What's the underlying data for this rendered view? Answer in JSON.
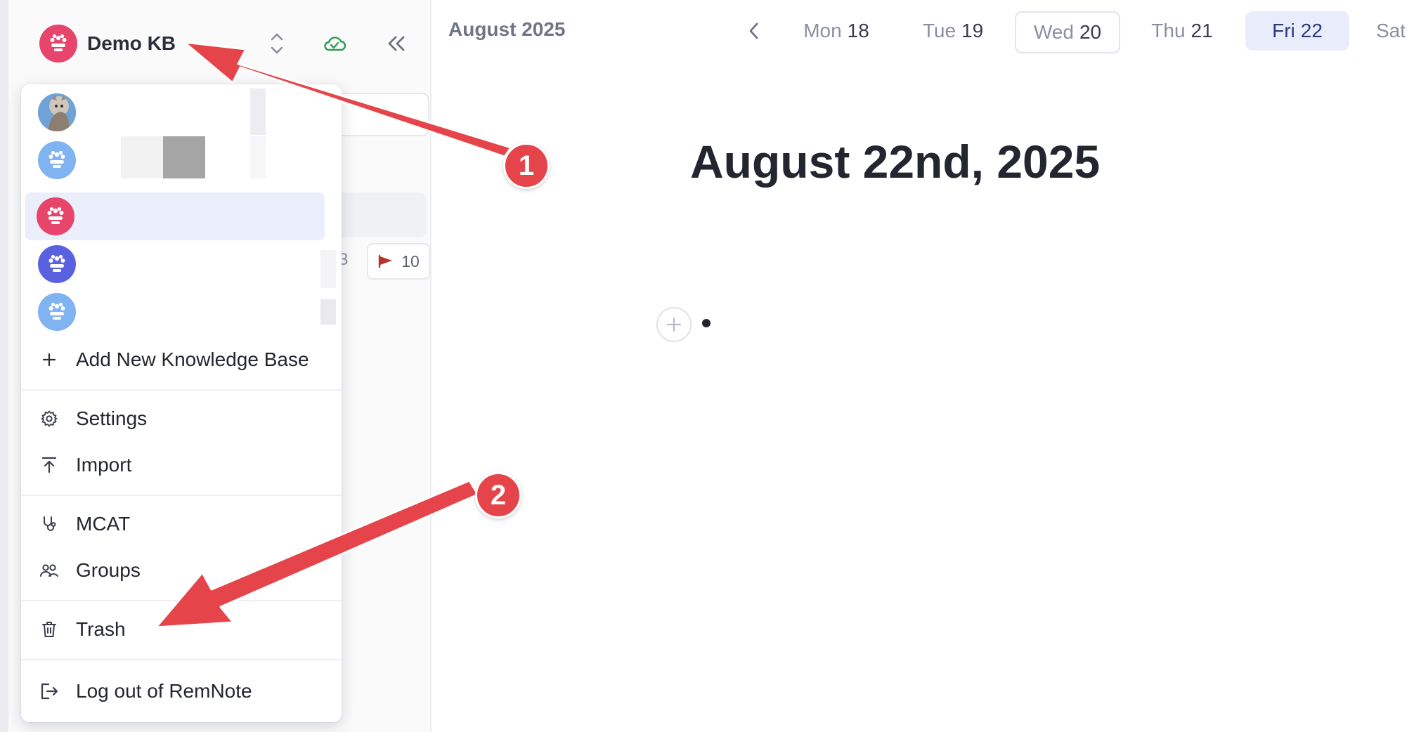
{
  "sidebar": {
    "kb_title": "Demo KB",
    "flag_count": "10",
    "partial_count": "3"
  },
  "dropdown": {
    "knowledge_bases": [
      {
        "avatar": "cat-photo-avatar"
      },
      {
        "avatar": "kb-avatar-lightblue"
      },
      {
        "avatar": "kb-avatar-pink",
        "active": true
      },
      {
        "avatar": "kb-avatar-indigo"
      },
      {
        "avatar": "kb-avatar-lightblue"
      }
    ],
    "add_kb_label": "Add New Knowledge Base",
    "settings_label": "Settings",
    "import_label": "Import",
    "mcat_label": "MCAT",
    "groups_label": "Groups",
    "trash_label": "Trash",
    "logout_label": "Log out of RemNote"
  },
  "calendar": {
    "month": "August 2025",
    "days": [
      {
        "name": "Mon",
        "num": "18"
      },
      {
        "name": "Tue",
        "num": "19"
      },
      {
        "name": "Wed",
        "num": "20",
        "state": "today"
      },
      {
        "name": "Thu",
        "num": "21"
      },
      {
        "name": "Fri",
        "num": "22",
        "state": "selected"
      },
      {
        "name": "Sat",
        "num": ""
      }
    ]
  },
  "document": {
    "title": "August 22nd, 2025"
  },
  "annotations": {
    "step1": "1",
    "step2": "2",
    "arrow_color": "#e5454a"
  },
  "colors": {
    "accent_pink": "#e8456d",
    "avatar_lightblue": "#7fb3f1",
    "avatar_indigo": "#5a61e0",
    "sync_green": "#2e9b52",
    "flag_red": "#b3352b"
  }
}
